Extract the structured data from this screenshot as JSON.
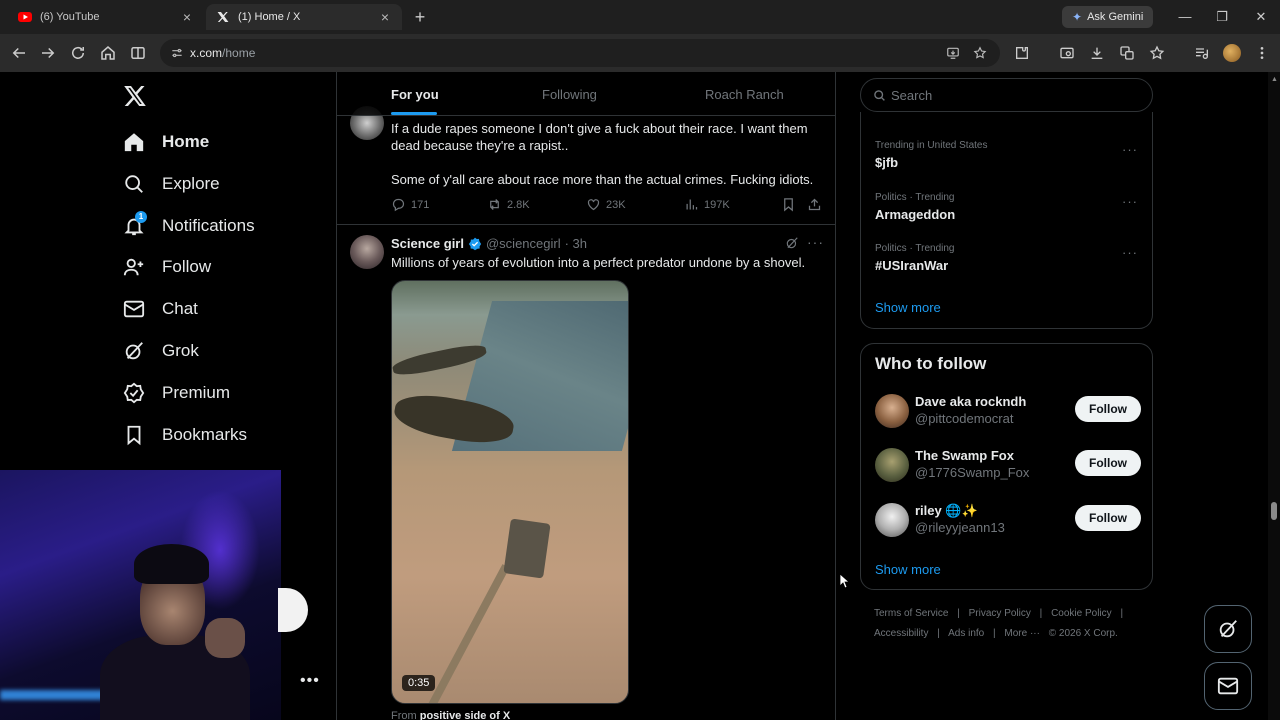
{
  "browser": {
    "tabs": [
      {
        "title": "(6) YouTube",
        "icon": "youtube-icon"
      },
      {
        "title": "(1) Home / X",
        "icon": "x-icon"
      }
    ],
    "gemini_label": "Ask Gemini",
    "url_host": "x.com",
    "url_path": "/home"
  },
  "sidebar": {
    "items": [
      {
        "label": "Home",
        "icon": "home-icon"
      },
      {
        "label": "Explore",
        "icon": "search-icon"
      },
      {
        "label": "Notifications",
        "icon": "bell-icon",
        "badge": "1"
      },
      {
        "label": "Follow",
        "icon": "add-person-icon"
      },
      {
        "label": "Chat",
        "icon": "mail-icon"
      },
      {
        "label": "Grok",
        "icon": "grok-icon"
      },
      {
        "label": "Premium",
        "icon": "verified-icon"
      },
      {
        "label": "Bookmarks",
        "icon": "bookmark-icon"
      }
    ]
  },
  "feed": {
    "tabs": [
      "For you",
      "Following",
      "Roach Ranch"
    ],
    "tweet1": {
      "line1": "If a dude rapes someone I don't give a fuck about their race. I want them",
      "line2": "dead because they're a rapist..",
      "line3": "Some of y'all care about race more than the actual crimes. Fucking idiots.",
      "replies": "171",
      "reposts": "2.8K",
      "likes": "23K",
      "views": "197K"
    },
    "tweet2": {
      "name": "Science girl",
      "handle": "@sciencegirl",
      "time": "· 3h",
      "text": "Millions of years of evolution into a perfect predator undone by a shovel.",
      "video_duration": "0:35",
      "from_prefix": "From",
      "from_source": "positive side of X"
    }
  },
  "right": {
    "search_placeholder": "Search",
    "trends": [
      {
        "meta": "Trending in United States",
        "title": "$jfb"
      },
      {
        "meta": "Politics · Trending",
        "title": "Armageddon"
      },
      {
        "meta": "Politics · Trending",
        "title": "#USIranWar"
      }
    ],
    "show_more": "Show more",
    "who_to_follow_title": "Who to follow",
    "suggestions": [
      {
        "name": "Dave aka rockndh",
        "handle": "@pittcodemocrat"
      },
      {
        "name": "The Swamp Fox",
        "handle": "@1776Swamp_Fox"
      },
      {
        "name": "riley 🌐✨",
        "handle": "@rileyyjeann13"
      }
    ],
    "follow_label": "Follow",
    "footer_row1": [
      "Terms of Service",
      "|",
      "Privacy Policy",
      "|",
      "Cookie Policy",
      "|"
    ],
    "footer_row2": [
      "Accessibility",
      "|",
      "Ads info",
      "|",
      "More ···",
      "© 2026 X Corp."
    ]
  },
  "colors": {
    "accent": "#1d9bf0",
    "background": "#000000",
    "border": "#2f3336",
    "muted_text": "#71767b"
  }
}
